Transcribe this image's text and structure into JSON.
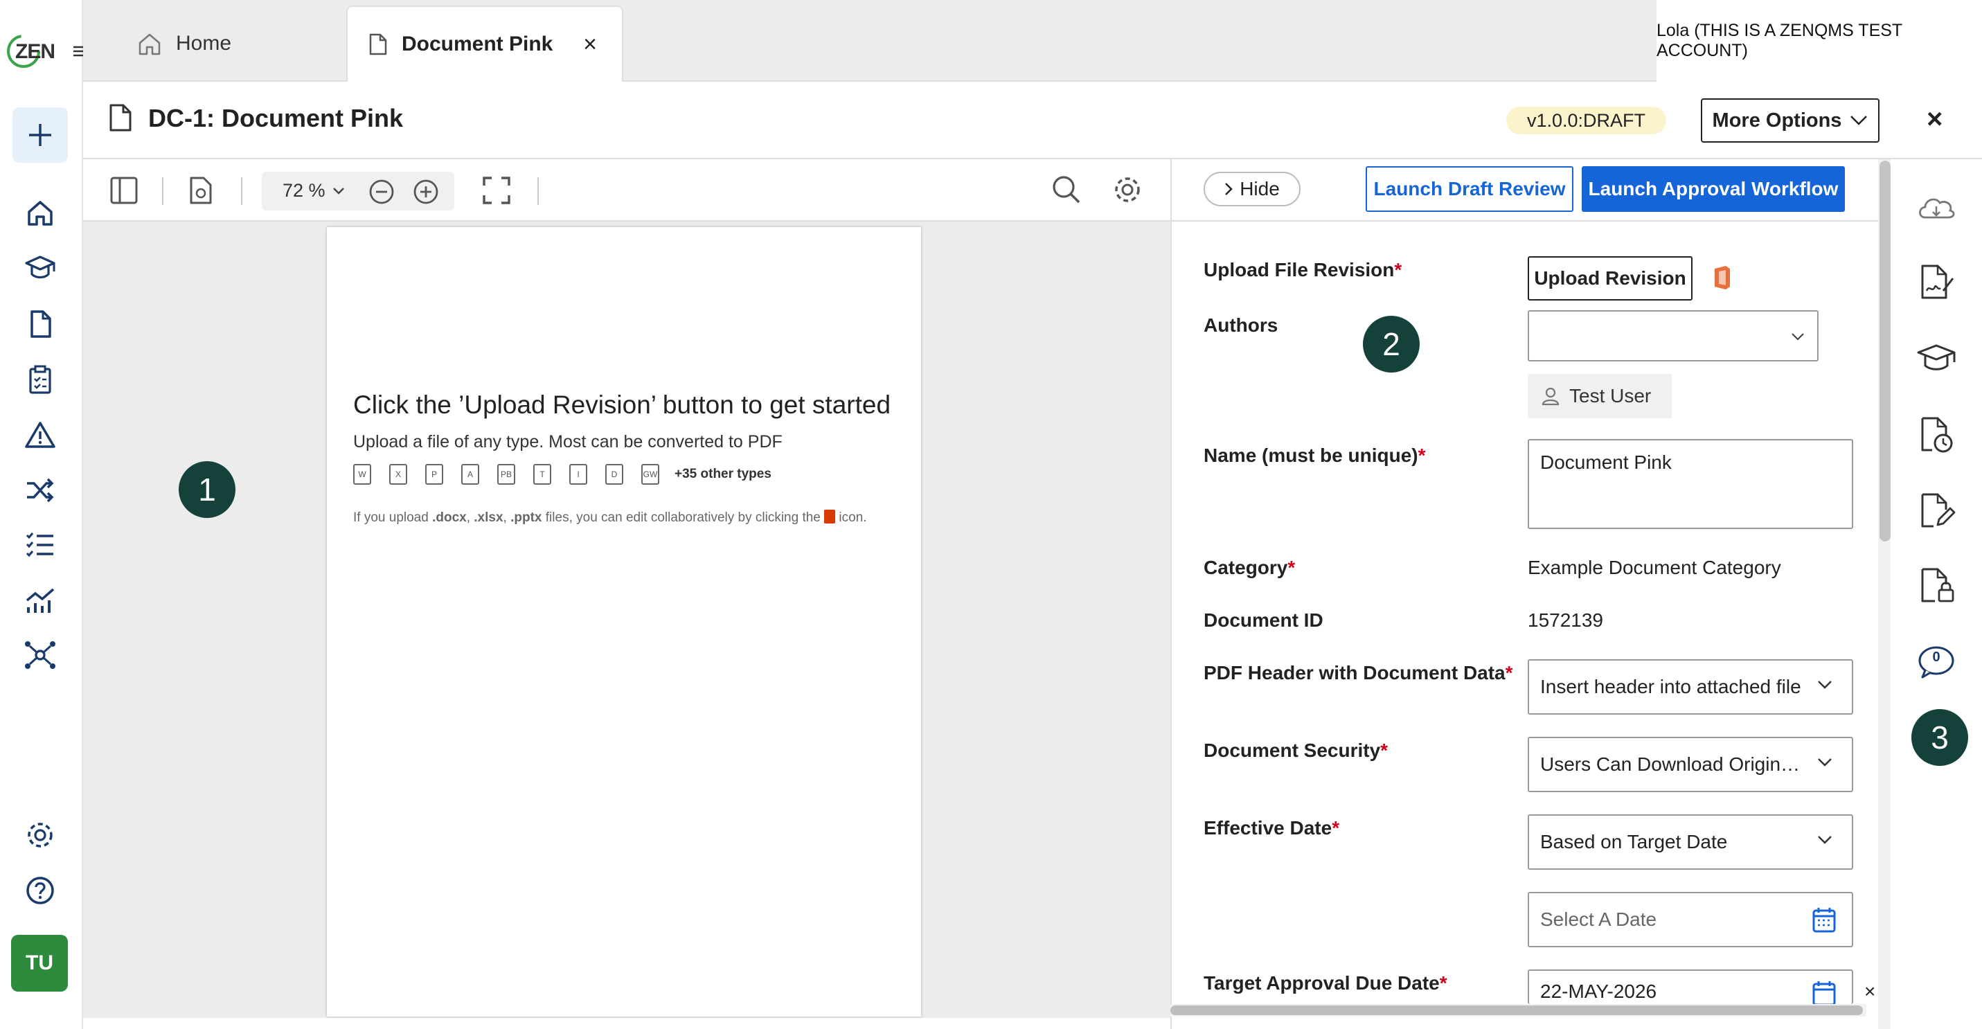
{
  "brand": {
    "logo_text": "ZEN"
  },
  "tabs": [
    {
      "label": "Home"
    },
    {
      "label": "Document Pink",
      "close": "×"
    }
  ],
  "user_account": "Lola (THIS IS A ZENQMS TEST ACCOUNT)",
  "header": {
    "title": "DC-1: Document Pink",
    "version": "v1.0.0:DRAFT",
    "more_options": "More Options",
    "close": "×"
  },
  "viewer": {
    "zoom": "72 %",
    "heading": "Click the ’Upload Revision’ button to get started",
    "subheading": "Upload a file of any type. Most can be converted to PDF",
    "file_types": [
      "W",
      "X",
      "P",
      "A",
      "PB",
      "T",
      "I",
      "D",
      "GW"
    ],
    "other_types": "+35 other types",
    "note_before": "If you upload ",
    "note_ext1": ".docx",
    "note_sep1": ", ",
    "note_ext2": ".xlsx",
    "note_sep2": ", ",
    "note_ext3": ".pptx",
    "note_after": " files, you can edit collaboratively by clicking the ",
    "note_end": " icon."
  },
  "markers": [
    "1",
    "2",
    "3"
  ],
  "panel": {
    "hide": "Hide",
    "launch_draft_review": "Launch Draft Review",
    "launch_approval_workflow": "Launch Approval Workflow",
    "fields": {
      "upload_label": "Upload File Revision",
      "upload_button": "Upload Revision",
      "authors_label": "Authors",
      "author_chip": "Test User",
      "name_label": "Name (must be unique)",
      "name_value": "Document Pink",
      "category_label": "Category",
      "category_value": "Example Document Category",
      "docid_label": "Document ID",
      "docid_value": "1572139",
      "pdfheader_label": "PDF Header with Document Data",
      "pdfheader_value": "Insert header into attached file",
      "security_label": "Document Security",
      "security_value": "Users Can Download Origina...",
      "effective_label": "Effective Date",
      "effective_value": "Based on Target Date",
      "date_placeholder": "Select A Date",
      "target_label": "Target Approval Due Date",
      "target_value": "22-MAY-2026",
      "required_mark": "*"
    }
  },
  "rail": {
    "comments_count": "0"
  },
  "sidebar": {
    "avatar_initials": "TU"
  },
  "colors": {
    "primary": "#1565d8",
    "marker": "#14423a",
    "avatar": "#2e8b3e",
    "required": "#d0021b",
    "badge": "#fbf3cc"
  }
}
